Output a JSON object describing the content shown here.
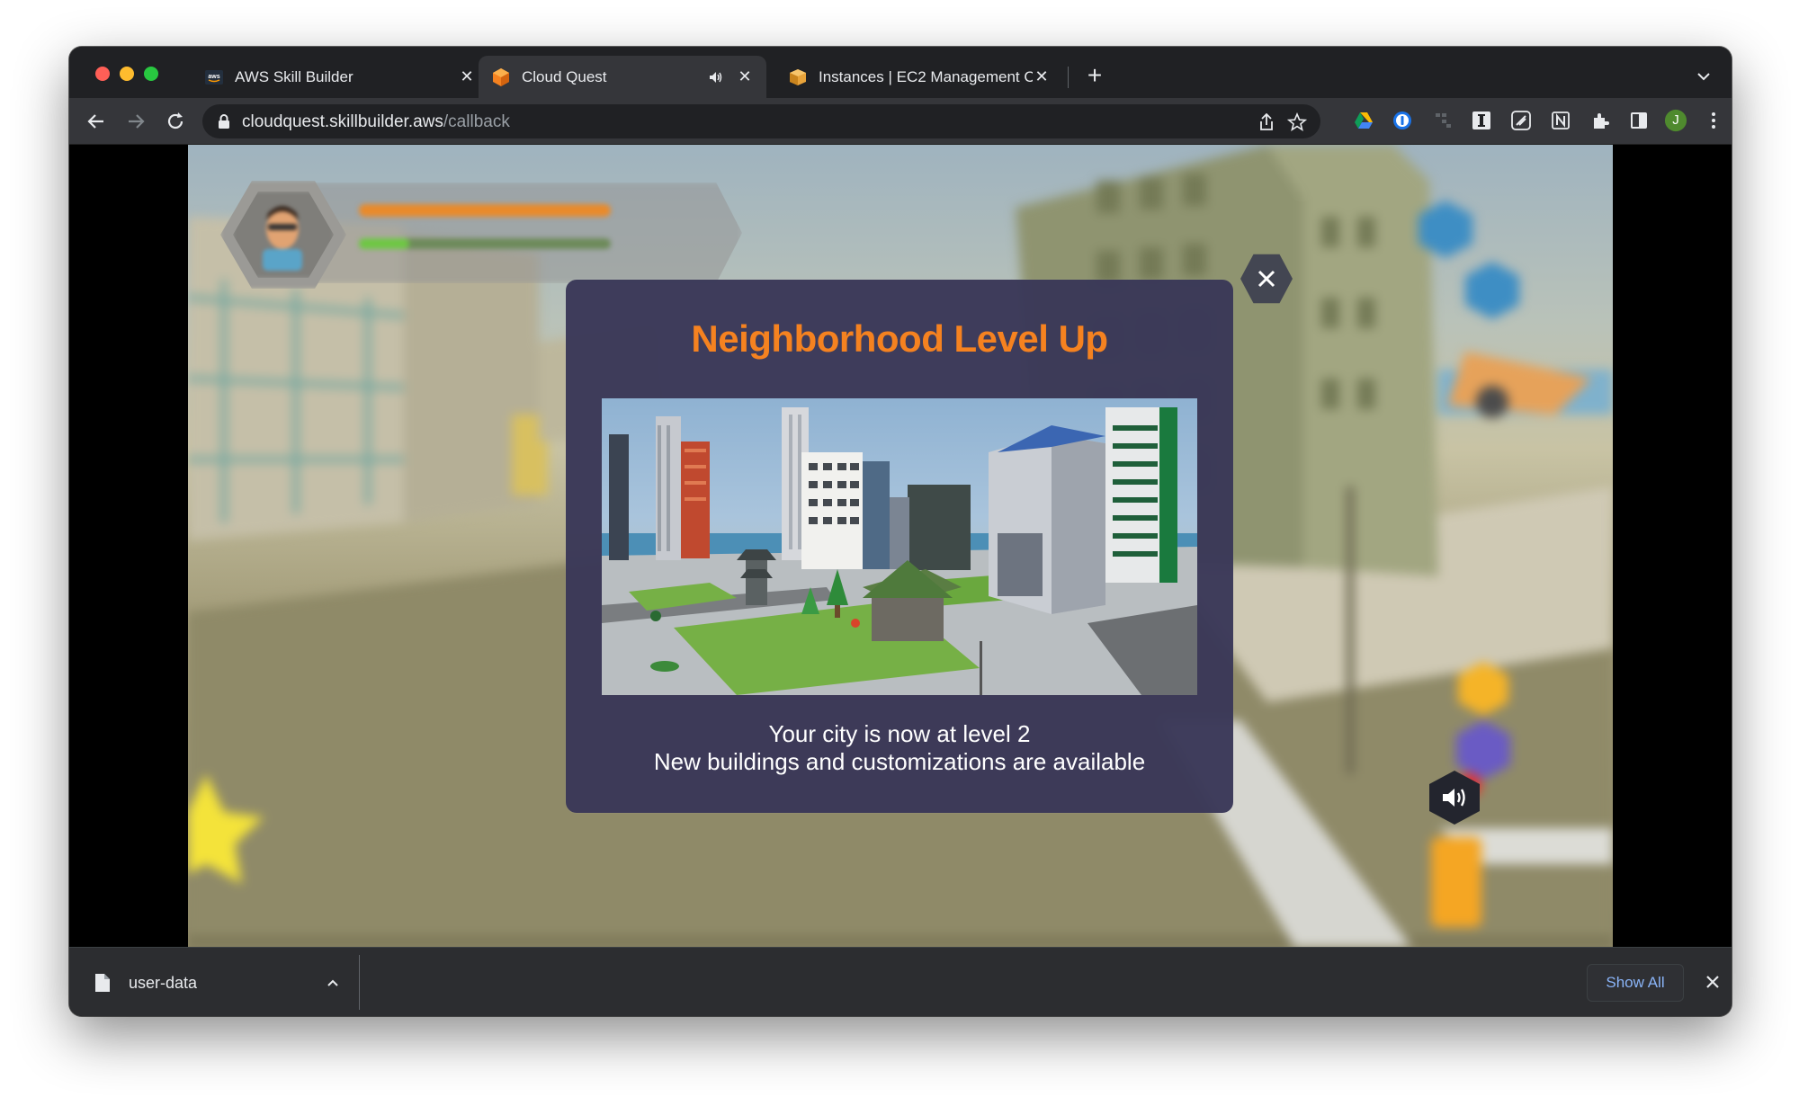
{
  "browser": {
    "tabs": [
      {
        "title": "AWS Skill Builder",
        "favicon": "aws-logo-icon",
        "active": false
      },
      {
        "title": "Cloud Quest",
        "favicon": "cloud-quest-cube-icon",
        "active": true,
        "muted_indicator": "speaker-icon"
      },
      {
        "title": "Instances | EC2 Management C",
        "favicon": "ec2-box-icon",
        "active": false
      }
    ],
    "new_tab_label": "+",
    "url": {
      "host": "cloudquest.skillbuilder.aws",
      "path": "/callback"
    },
    "profile_initial": "J",
    "colors": {
      "tab_strip": "#202124",
      "toolbar": "#35363a",
      "accent_link": "#8ab4f8",
      "profile_avatar": "#4f8a2e"
    }
  },
  "game": {
    "modal": {
      "title": "Neighborhood Level Up",
      "line1": "Your city is now at level 2",
      "line2": "New buildings and customizations are available",
      "title_color": "#f58220",
      "background": "#3a3858"
    },
    "hud": {
      "avatar": "player-avatar",
      "xp_bar_color": "#e98a2b",
      "progress_bar_color": "#6ec744"
    }
  },
  "downloads": {
    "file_name": "user-data",
    "show_all_label": "Show All"
  }
}
